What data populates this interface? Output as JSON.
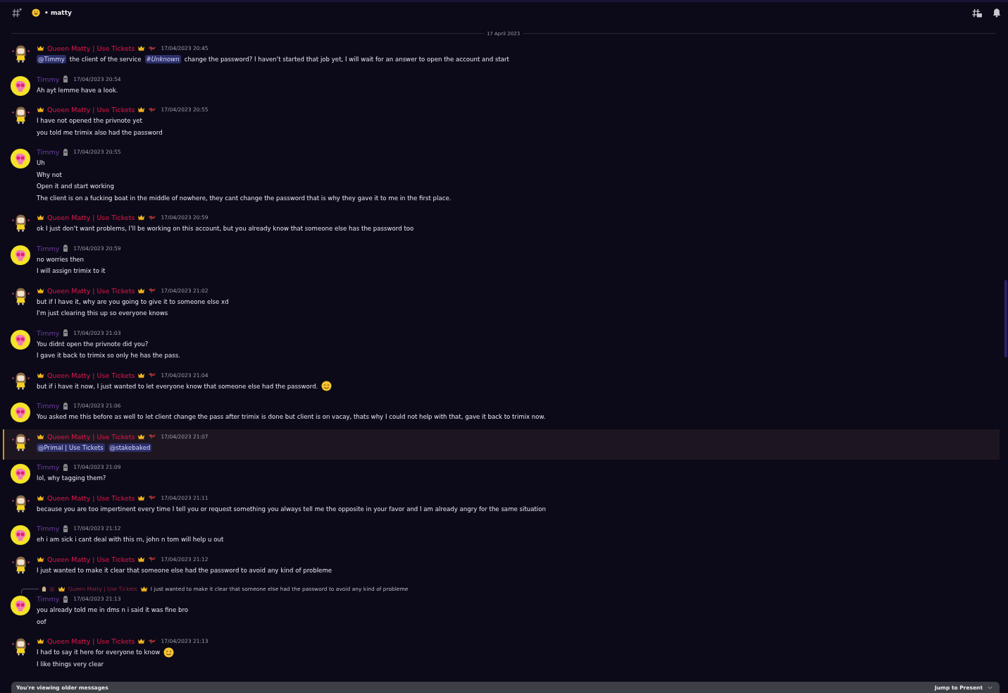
{
  "header": {
    "channel": "• matty"
  },
  "date_divider": "17 April 2023",
  "messages": [
    {
      "author": "Queen Matty | Use Tickets",
      "kind": "queen",
      "time": "17/04/2023 20:45",
      "highlighted": false,
      "lines": [
        [
          {
            "kind": "mention",
            "text": "@Timmy"
          },
          {
            "kind": "text",
            "text": "the client of the service"
          },
          {
            "kind": "channel",
            "text": "#Unknown"
          },
          {
            "kind": "text",
            "text": "change the password? I haven't started that job yet, I will wait for an answer to open the account and start"
          }
        ]
      ]
    },
    {
      "author": "Timmy",
      "kind": "timmy",
      "time": "17/04/2023 20:54",
      "highlighted": false,
      "lines": [
        [
          {
            "kind": "text",
            "text": "Ah ayt lemme have a look."
          }
        ]
      ]
    },
    {
      "author": "Queen Matty | Use Tickets",
      "kind": "queen",
      "time": "17/04/2023 20:55",
      "highlighted": false,
      "lines": [
        [
          {
            "kind": "text",
            "text": "I have not opened the privnote yet"
          }
        ],
        [
          {
            "kind": "text",
            "text": "you told me trimix also had the password"
          }
        ]
      ]
    },
    {
      "author": "Timmy",
      "kind": "timmy",
      "time": "17/04/2023 20:55",
      "highlighted": false,
      "lines": [
        [
          {
            "kind": "text",
            "text": "Uh"
          }
        ],
        [
          {
            "kind": "text",
            "text": "Why not"
          }
        ],
        [
          {
            "kind": "text",
            "text": "Open it and start working"
          }
        ],
        [
          {
            "kind": "text",
            "text": "The client is on a fucking boat in the middle of nowhere, they cant change the password that is why they gave it to me in the first place."
          }
        ]
      ]
    },
    {
      "author": "Queen Matty | Use Tickets",
      "kind": "queen",
      "time": "17/04/2023 20:59",
      "highlighted": false,
      "lines": [
        [
          {
            "kind": "text",
            "text": "ok I just don't want problems, I'll be working on this account, but you already know that someone else has the password too"
          }
        ]
      ]
    },
    {
      "author": "Timmy",
      "kind": "timmy",
      "time": "17/04/2023 20:59",
      "highlighted": false,
      "lines": [
        [
          {
            "kind": "text",
            "text": "no worries then"
          }
        ],
        [
          {
            "kind": "text",
            "text": "I will assign trimix to it"
          }
        ]
      ]
    },
    {
      "author": "Queen Matty | Use Tickets",
      "kind": "queen",
      "time": "17/04/2023 21:02",
      "highlighted": false,
      "lines": [
        [
          {
            "kind": "text",
            "text": "but if I have it, why are you going to give it to someone else xd"
          }
        ],
        [
          {
            "kind": "text",
            "text": "I'm just clearing this up so everyone knows"
          }
        ]
      ]
    },
    {
      "author": "Timmy",
      "kind": "timmy",
      "time": "17/04/2023 21:03",
      "highlighted": false,
      "lines": [
        [
          {
            "kind": "text",
            "text": "You didnt open the privnote did you?"
          }
        ],
        [
          {
            "kind": "text",
            "text": "I gave it back to trimix so only he has the pass."
          }
        ]
      ]
    },
    {
      "author": "Queen Matty | Use Tickets",
      "kind": "queen",
      "time": "17/04/2023 21:04",
      "highlighted": false,
      "lines": [
        [
          {
            "kind": "text",
            "text": "but if i have it now, I just wanted to let everyone know that someone else had the password."
          },
          {
            "kind": "emoji"
          }
        ]
      ]
    },
    {
      "author": "Timmy",
      "kind": "timmy",
      "time": "17/04/2023 21:06",
      "highlighted": false,
      "lines": [
        [
          {
            "kind": "text",
            "text": "You asked me this before as well to let client change the pass after trimix is done but client is on vacay, thats why I could not help with that, gave it back to trimix now."
          }
        ]
      ]
    },
    {
      "author": "Queen Matty | Use Tickets",
      "kind": "queen",
      "time": "17/04/2023 21:07",
      "highlighted": true,
      "lines": [
        [
          {
            "kind": "mention",
            "text": "@Primal | Use Tickets"
          },
          {
            "kind": "mention",
            "text": "@stakebaked"
          }
        ]
      ]
    },
    {
      "author": "Timmy",
      "kind": "timmy",
      "time": "17/04/2023 21:09",
      "highlighted": false,
      "lines": [
        [
          {
            "kind": "text",
            "text": "lol, why tagging them?"
          }
        ]
      ]
    },
    {
      "author": "Queen Matty | Use Tickets",
      "kind": "queen",
      "time": "17/04/2023 21:11",
      "highlighted": false,
      "lines": [
        [
          {
            "kind": "text",
            "text": "because you are too impertinent every time I tell you or request something you always tell me the opposite in your favor and I am already angry for the same situation"
          }
        ]
      ]
    },
    {
      "author": "Timmy",
      "kind": "timmy",
      "time": "17/04/2023 21:12",
      "highlighted": false,
      "lines": [
        [
          {
            "kind": "text",
            "text": "eh i am sick i cant deal with this rn, john n tom will help u out"
          }
        ]
      ]
    },
    {
      "author": "Queen Matty | Use Tickets",
      "kind": "queen",
      "time": "17/04/2023 21:12",
      "highlighted": false,
      "lines": [
        [
          {
            "kind": "text",
            "text": "I just wanted to make it clear that someone else had the password to avoid any kind of probleme"
          }
        ]
      ]
    },
    {
      "author": "Timmy",
      "kind": "timmy",
      "time": "17/04/2023 21:13",
      "highlighted": false,
      "reply": {
        "mention": "@",
        "author": "Queen Matty | Use Tickets",
        "text": "I just wanted to make it clear that someone else had the password to avoid any kind of probleme"
      },
      "lines": [
        [
          {
            "kind": "text",
            "text": "you already told me in dms n i said it was fine bro"
          }
        ],
        [
          {
            "kind": "text",
            "text": "oof"
          }
        ]
      ]
    },
    {
      "author": "Queen Matty | Use Tickets",
      "kind": "queen",
      "time": "17/04/2023 21:13",
      "highlighted": false,
      "lines": [
        [
          {
            "kind": "text",
            "text": "I had to say it here for everyone to know"
          },
          {
            "kind": "emoji"
          }
        ],
        [
          {
            "kind": "text",
            "text": "I like things very clear"
          }
        ]
      ]
    }
  ],
  "older_bar": {
    "text": "You're viewing older messages",
    "button": "Jump to Present"
  }
}
